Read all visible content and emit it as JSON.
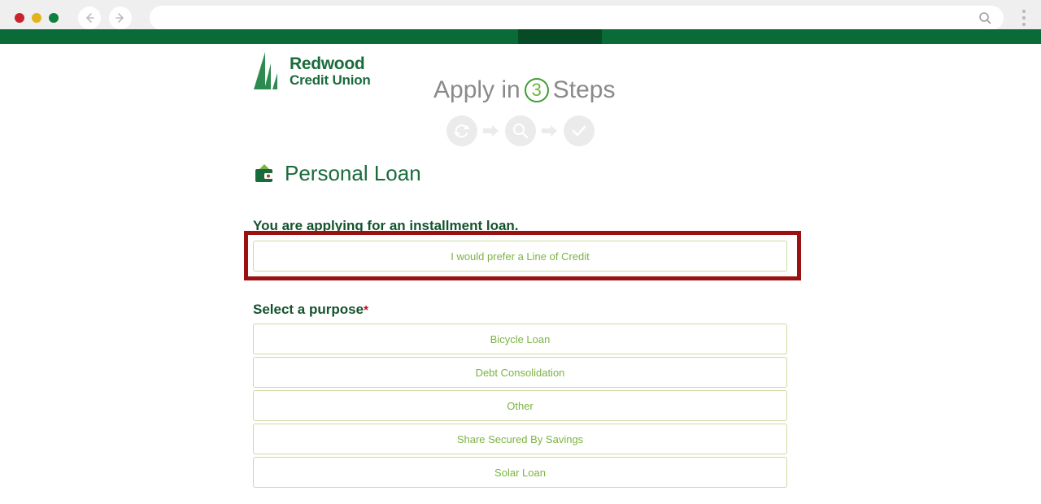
{
  "browser": {
    "url_value": "",
    "url_placeholder": "",
    "back_icon": "back-arrow-icon",
    "forward_icon": "forward-arrow-icon",
    "search_icon": "search-icon",
    "menu_icon": "kebab-menu-icon",
    "traffic_lights": [
      "close-red",
      "minimize-yellow",
      "maximize-green"
    ]
  },
  "site_nav": {
    "items": [
      {
        "label": ""
      },
      {
        "label": ""
      }
    ],
    "active_index": 1,
    "bar_color": "#0a6b38",
    "active_color": "#064a26"
  },
  "brand": {
    "line1": "Redwood",
    "line2": "Credit Union",
    "logo_icon": "redwood-tree-logo-icon",
    "color": "#1a6b3c"
  },
  "apply_heading": {
    "before": "Apply in",
    "number": "3",
    "after": "Steps",
    "text_color": "#8a8a8a",
    "number_color": "#6db33f"
  },
  "steps": [
    {
      "icon": "refresh-cycle-icon",
      "name": "step-1"
    },
    {
      "icon": "arrow-right-icon",
      "name": "step-arrow-1"
    },
    {
      "icon": "magnifier-icon",
      "name": "step-2"
    },
    {
      "icon": "arrow-right-icon",
      "name": "step-arrow-2"
    },
    {
      "icon": "checkmark-icon",
      "name": "step-3"
    }
  ],
  "loan": {
    "title": "Personal Loan",
    "title_icon": "wallet-icon",
    "installment_notice": "You are applying for an installment loan.",
    "line_of_credit_label": "I would prefer a Line of Credit"
  },
  "purpose": {
    "label": "Select a purpose",
    "required_mark": "*",
    "options": [
      {
        "label": "Bicycle Loan"
      },
      {
        "label": "Debt Consolidation"
      },
      {
        "label": "Other"
      },
      {
        "label": "Share Secured By Savings"
      },
      {
        "label": "Solar Loan"
      }
    ]
  },
  "annotation": {
    "color": "#9b1010",
    "target": "line-of-credit-button"
  }
}
